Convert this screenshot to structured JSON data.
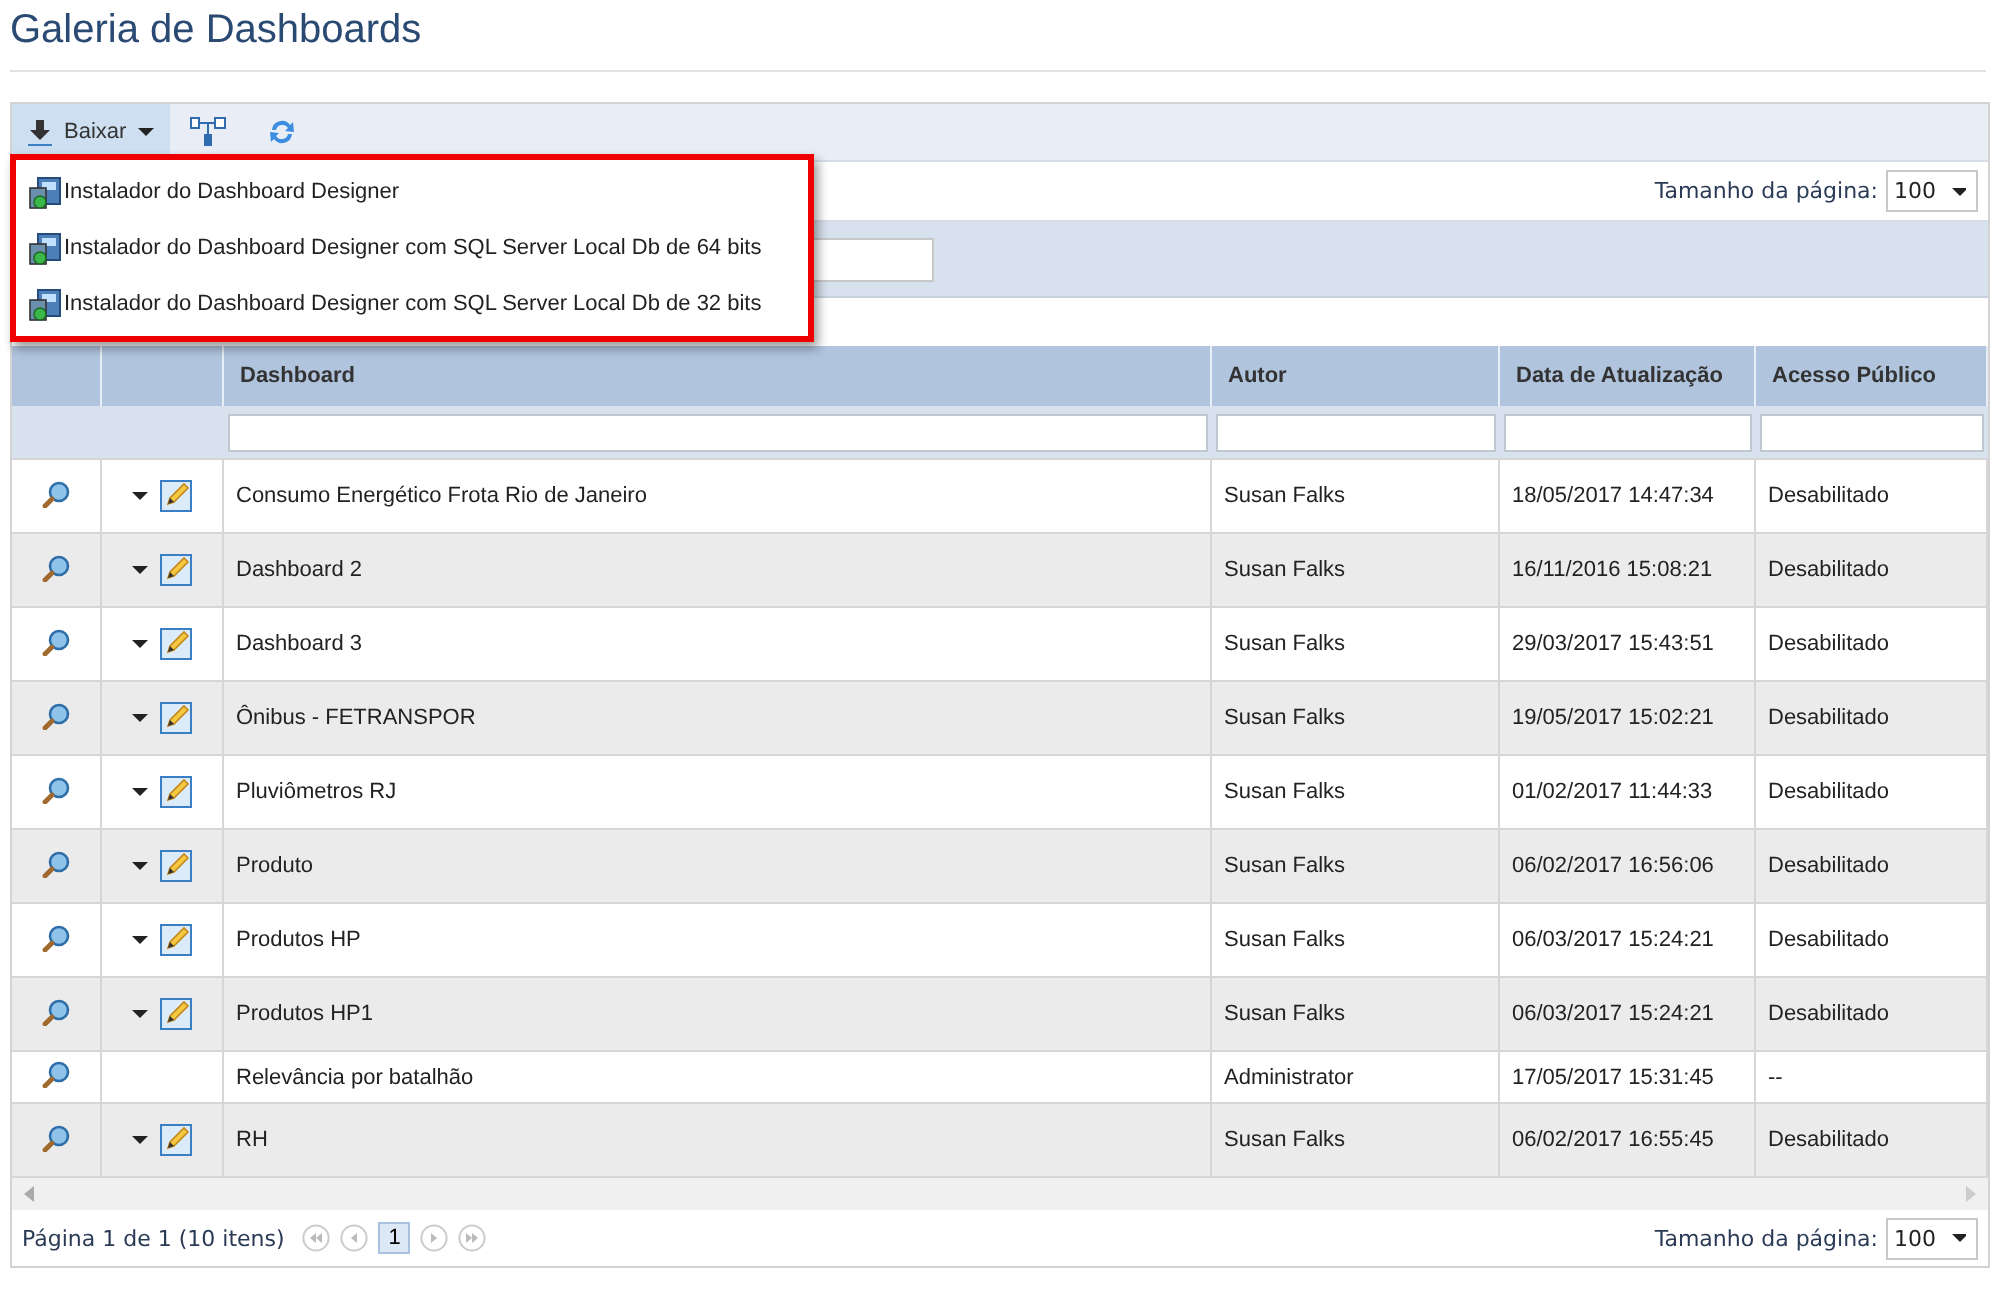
{
  "page": {
    "title": "Galeria de Dashboards"
  },
  "toolbar": {
    "download_button": {
      "label": "Baixar",
      "expanded": true
    }
  },
  "download_menu": {
    "items": [
      {
        "label": "Instalador do Dashboard Designer"
      },
      {
        "label": "Instalador do Dashboard Designer com SQL Server Local Db de 64 bits"
      },
      {
        "label": "Instalador do Dashboard Designer com SQL Server Local Db de 32 bits"
      }
    ]
  },
  "top_pager": {
    "page_size_label": "Tamanho da página:",
    "page_size": "100"
  },
  "table": {
    "columns": [
      "Dashboard",
      "Autor",
      "Data de Atualização",
      "Acesso Público"
    ],
    "rows": [
      {
        "name": "Consumo Energético Frota Rio de Janeiro",
        "author": "Susan Falks",
        "updated": "18/05/2017 14:47:34",
        "public_access": "Desabilitado",
        "editable": true
      },
      {
        "name": "Dashboard 2",
        "author": "Susan Falks",
        "updated": "16/11/2016 15:08:21",
        "public_access": "Desabilitado",
        "editable": true
      },
      {
        "name": "Dashboard 3",
        "author": "Susan Falks",
        "updated": "29/03/2017 15:43:51",
        "public_access": "Desabilitado",
        "editable": true
      },
      {
        "name": "Ônibus - FETRANSPOR",
        "author": "Susan Falks",
        "updated": "19/05/2017 15:02:21",
        "public_access": "Desabilitado",
        "editable": true
      },
      {
        "name": "Pluviômetros RJ",
        "author": "Susan Falks",
        "updated": "01/02/2017 11:44:33",
        "public_access": "Desabilitado",
        "editable": true
      },
      {
        "name": "Produto",
        "author": "Susan Falks",
        "updated": "06/02/2017 16:56:06",
        "public_access": "Desabilitado",
        "editable": true
      },
      {
        "name": "Produtos HP",
        "author": "Susan Falks",
        "updated": "06/03/2017 15:24:21",
        "public_access": "Desabilitado",
        "editable": true
      },
      {
        "name": "Produtos HP1",
        "author": "Susan Falks",
        "updated": "06/03/2017 15:24:21",
        "public_access": "Desabilitado",
        "editable": true
      },
      {
        "name": "Relevância por batalhão",
        "author": "Administrator",
        "updated": "17/05/2017 15:31:45",
        "public_access": "--",
        "editable": false
      },
      {
        "name": "RH",
        "author": "Susan Falks",
        "updated": "06/02/2017 16:55:45",
        "public_access": "Desabilitado",
        "editable": true
      }
    ]
  },
  "bottom_pager": {
    "summary": "Página 1 de 1 (10 itens)",
    "pages": [
      {
        "label": "1",
        "selected": true
      }
    ],
    "page_size_label": "Tamanho da página:",
    "page_size": "100"
  }
}
